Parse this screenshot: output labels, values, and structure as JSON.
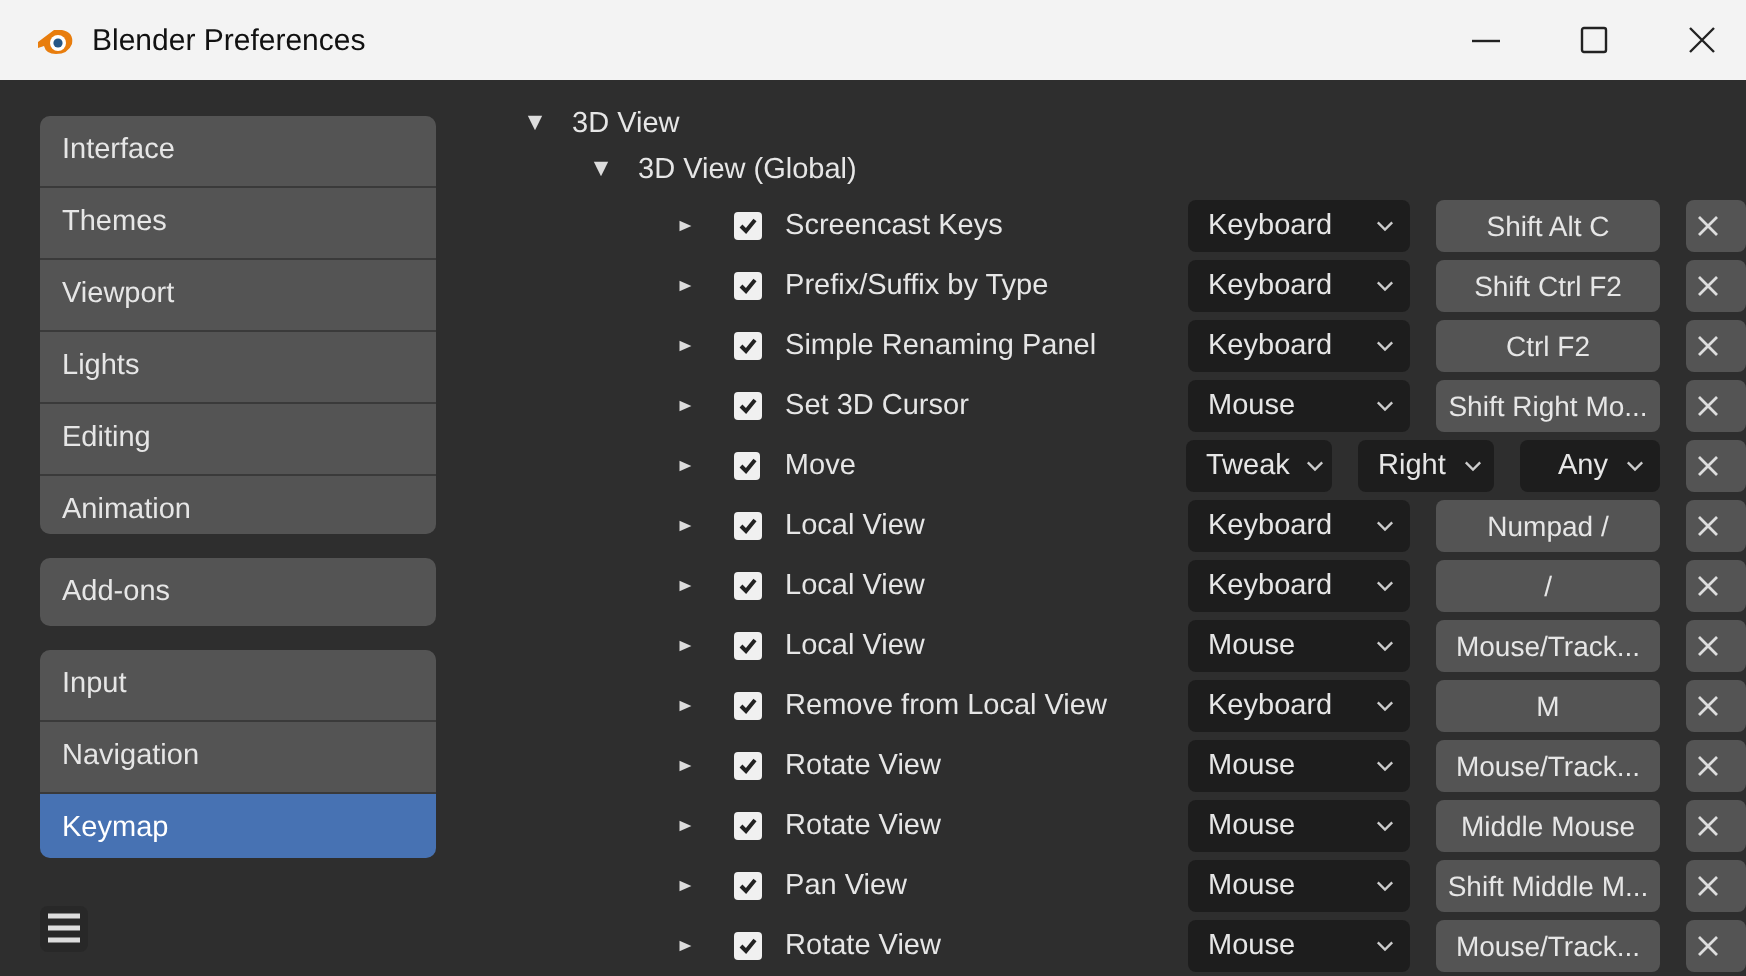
{
  "window": {
    "title": "Blender Preferences"
  },
  "sidebar": {
    "groups": [
      [
        {
          "label": "Interface",
          "selected": false
        },
        {
          "label": "Themes",
          "selected": false
        },
        {
          "label": "Viewport",
          "selected": false
        },
        {
          "label": "Lights",
          "selected": false
        },
        {
          "label": "Editing",
          "selected": false
        },
        {
          "label": "Animation",
          "selected": false
        }
      ],
      [
        {
          "label": "Add-ons",
          "selected": false
        }
      ],
      [
        {
          "label": "Input",
          "selected": false
        },
        {
          "label": "Navigation",
          "selected": false
        },
        {
          "label": "Keymap",
          "selected": true
        }
      ]
    ]
  },
  "keymap": {
    "label": "3D View",
    "expanded": true,
    "children": [
      {
        "label": "3D View (Global)",
        "expanded": true,
        "rows": [
          {
            "kind": "key",
            "expanded": false,
            "checked": true,
            "label": "Screencast Keys",
            "input_type": "Keyboard",
            "key": "Shift Alt C"
          },
          {
            "kind": "key",
            "expanded": false,
            "checked": true,
            "label": "Prefix/Suffix by Type",
            "input_type": "Keyboard",
            "key": "Shift Ctrl F2"
          },
          {
            "kind": "key",
            "expanded": false,
            "checked": true,
            "label": "Simple Renaming Panel",
            "input_type": "Keyboard",
            "key": "Ctrl F2"
          },
          {
            "kind": "key",
            "expanded": false,
            "checked": true,
            "label": "Set 3D Cursor",
            "input_type": "Mouse",
            "key": "Shift Right Mo..."
          },
          {
            "kind": "tweak",
            "expanded": false,
            "checked": true,
            "label": "Move",
            "input_type": "Tweak",
            "button": "Right",
            "direction": "Any"
          },
          {
            "kind": "key",
            "expanded": false,
            "checked": true,
            "label": "Local View",
            "input_type": "Keyboard",
            "key": "Numpad /"
          },
          {
            "kind": "key",
            "expanded": false,
            "checked": true,
            "label": "Local View",
            "input_type": "Keyboard",
            "key": "/"
          },
          {
            "kind": "key",
            "expanded": false,
            "checked": true,
            "label": "Local View",
            "input_type": "Mouse",
            "key": "Mouse/Track..."
          },
          {
            "kind": "key",
            "expanded": false,
            "checked": true,
            "label": "Remove from Local View",
            "input_type": "Keyboard",
            "key": "M"
          },
          {
            "kind": "key",
            "expanded": false,
            "checked": true,
            "label": "Rotate View",
            "input_type": "Mouse",
            "key": "Mouse/Track..."
          },
          {
            "kind": "key",
            "expanded": false,
            "checked": true,
            "label": "Rotate View",
            "input_type": "Mouse",
            "key": "Middle Mouse"
          },
          {
            "kind": "key",
            "expanded": false,
            "checked": true,
            "label": "Pan View",
            "input_type": "Mouse",
            "key": "Shift Middle M..."
          },
          {
            "kind": "key",
            "expanded": false,
            "checked": true,
            "label": "Rotate View",
            "input_type": "Mouse",
            "key": "Mouse/Track..."
          }
        ]
      }
    ]
  }
}
